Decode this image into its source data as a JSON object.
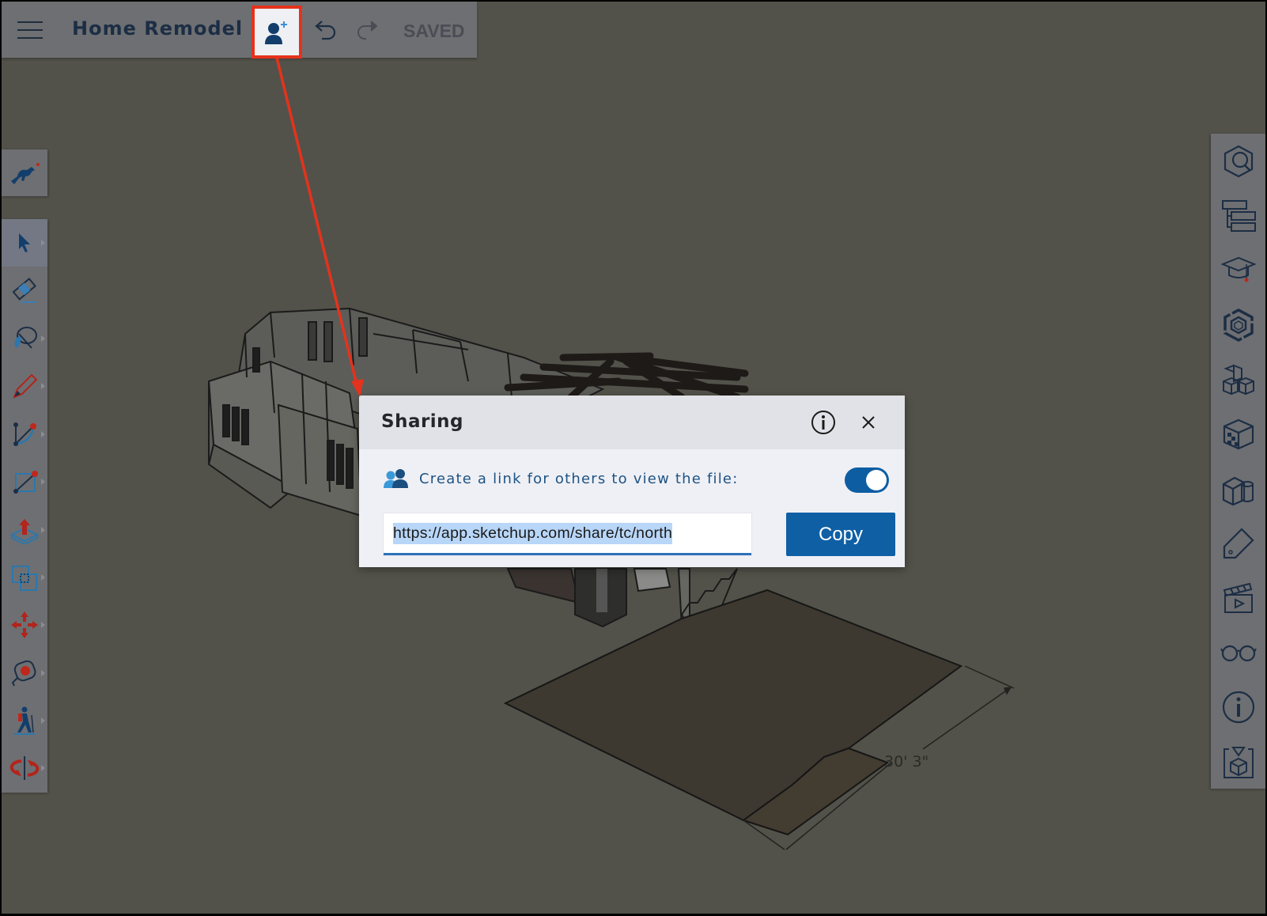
{
  "app": {
    "document_title": "Home Remodel",
    "save_status": "SAVED"
  },
  "toolbar": {
    "menu_icon": "hamburger-icon",
    "share_icon": "add-user-icon",
    "undo_icon": "undo-icon",
    "redo_icon": "redo-icon"
  },
  "left_toolbar": {
    "top_item": "search-sketchup-dog-icon",
    "tools": [
      {
        "name": "select",
        "icon": "select-arrow-icon",
        "has_submenu": true,
        "active": true
      },
      {
        "name": "eraser",
        "icon": "eraser-icon",
        "has_submenu": false,
        "active": false
      },
      {
        "name": "paint-bucket",
        "icon": "paint-bucket-icon",
        "has_submenu": true,
        "active": false
      },
      {
        "name": "pencil",
        "icon": "pencil-icon",
        "has_submenu": true,
        "active": false
      },
      {
        "name": "arc",
        "icon": "arc-icon",
        "has_submenu": true,
        "active": false
      },
      {
        "name": "rectangle",
        "icon": "rectangle-icon",
        "has_submenu": true,
        "active": false
      },
      {
        "name": "push-pull",
        "icon": "push-pull-icon",
        "has_submenu": true,
        "active": false
      },
      {
        "name": "offset",
        "icon": "offset-icon",
        "has_submenu": true,
        "active": false
      },
      {
        "name": "move",
        "icon": "move-icon",
        "has_submenu": true,
        "active": false
      },
      {
        "name": "tape-measure",
        "icon": "tape-measure-icon",
        "has_submenu": true,
        "active": false
      },
      {
        "name": "walk",
        "icon": "walk-icon",
        "has_submenu": true,
        "active": false
      },
      {
        "name": "orbit",
        "icon": "orbit-icon",
        "has_submenu": true,
        "active": false
      }
    ]
  },
  "right_toolbar": {
    "items": [
      {
        "name": "entity-info",
        "icon": "entity-search-icon"
      },
      {
        "name": "outliner",
        "icon": "outliner-icon"
      },
      {
        "name": "instructor",
        "icon": "graduation-cap-icon"
      },
      {
        "name": "components",
        "icon": "component-hexagon-icon"
      },
      {
        "name": "3d-warehouse",
        "icon": "cubes-icon"
      },
      {
        "name": "materials",
        "icon": "materials-cube-icon"
      },
      {
        "name": "styles",
        "icon": "solids-icon"
      },
      {
        "name": "tags",
        "icon": "tag-icon"
      },
      {
        "name": "scenes",
        "icon": "clapperboard-icon"
      },
      {
        "name": "display",
        "icon": "glasses-icon"
      },
      {
        "name": "model-info",
        "icon": "info-icon"
      },
      {
        "name": "solid-inspector",
        "icon": "solid-cube-icon"
      }
    ]
  },
  "viewport": {
    "dimension_label": "30' 3\""
  },
  "sharing_dialog": {
    "title": "Sharing",
    "info_icon": "info-circle-icon",
    "close_icon": "close-icon",
    "share_label": "Create a link for others to view the file:",
    "share_label_icon": "users-icon",
    "link_enabled": true,
    "link_value": "https://app.sketchup.com/share/tc/north",
    "copy_label": "Copy"
  },
  "colors": {
    "accent_blue": "#0f5fa5",
    "annotation_red": "#e5321c",
    "viewport_bg": "#52524a",
    "title_navy": "#1c2e45"
  }
}
